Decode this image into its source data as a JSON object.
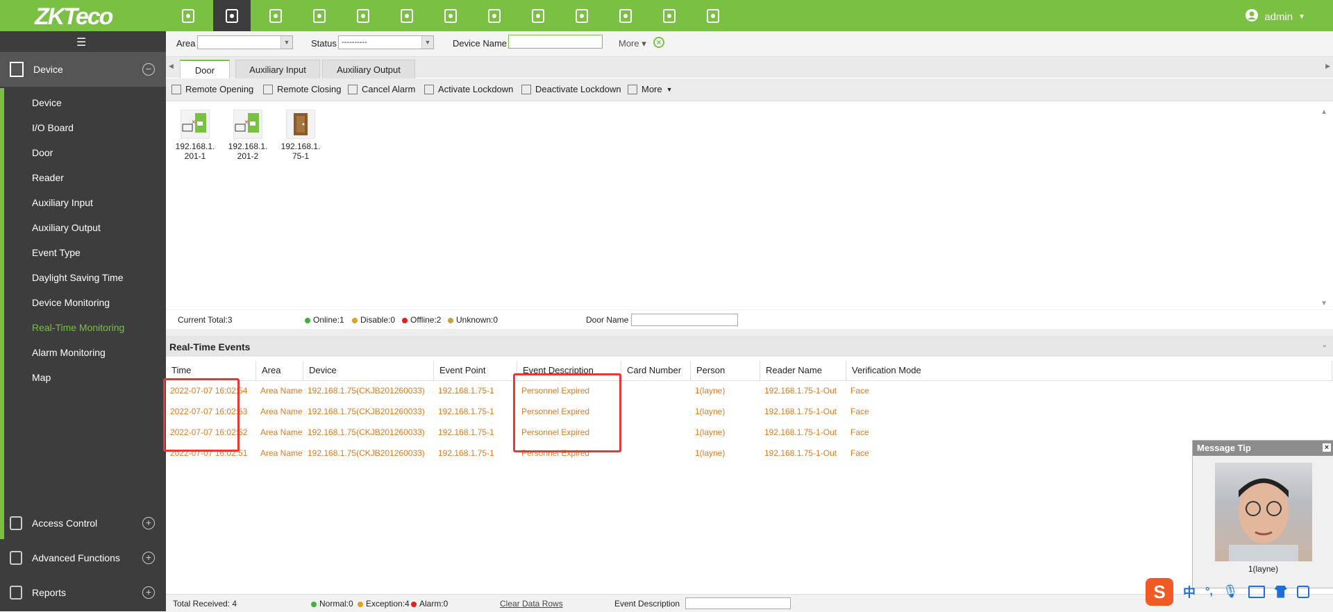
{
  "brand": {
    "logo": "ZKTeco"
  },
  "topnav": {
    "icons": [
      "personnel-icon",
      "access-door-icon",
      "time-attendance-icon",
      "visitor-icon",
      "elevator-icon",
      "consumption-icon",
      "parking-icon",
      "patrol-icon",
      "office-icon",
      "locker-icon",
      "video-icon",
      "security-icon",
      "settings-icon"
    ],
    "user": "admin"
  },
  "sidebar": {
    "section_title": "Device",
    "items": [
      "Device",
      "I/O Board",
      "Door",
      "Reader",
      "Auxiliary Input",
      "Auxiliary Output",
      "Event Type",
      "Daylight Saving Time",
      "Device Monitoring",
      "Real-Time Monitoring",
      "Alarm Monitoring",
      "Map"
    ],
    "active_item": "Real-Time Monitoring",
    "sections": [
      "Access Control",
      "Advanced Functions",
      "Reports"
    ]
  },
  "filter": {
    "area_label": "Area",
    "area_value": "",
    "status_label": "Status",
    "status_value": "----------",
    "device_name_label": "Device Name",
    "device_name_value": "",
    "more_label": "More"
  },
  "tabs": [
    "Door",
    "Auxiliary Input",
    "Auxiliary Output"
  ],
  "toolbar": [
    "Remote Opening",
    "Remote Closing",
    "Cancel Alarm",
    "Activate Lockdown",
    "Deactivate Lockdown",
    "More"
  ],
  "doors": [
    {
      "line1": "192.168.1.",
      "line2": "201-1",
      "state": "offline"
    },
    {
      "line1": "192.168.1.",
      "line2": "201-2",
      "state": "offline"
    },
    {
      "line1": "192.168.1.",
      "line2": "75-1",
      "state": "online"
    }
  ],
  "status": {
    "current_total": "Current Total:3",
    "online": "Online:1",
    "disable": "Disable:0",
    "offline": "Offline:2",
    "unknown": "Unknown:0",
    "door_name_label": "Door Name"
  },
  "events": {
    "title": "Real-Time Events",
    "columns": [
      "Time",
      "Area",
      "Device",
      "Event Point",
      "Event Description",
      "Card Number",
      "Person",
      "Reader Name",
      "Verification Mode"
    ],
    "rows": [
      [
        "2022-07-07 16:02:54",
        "Area Name",
        "192.168.1.75(CKJB201260033)",
        "192.168.1.75-1",
        "Personnel Expired",
        "",
        "1(layne)",
        "192.168.1.75-1-Out",
        "Face"
      ],
      [
        "2022-07-07 16:02:53",
        "Area Name",
        "192.168.1.75(CKJB201260033)",
        "192.168.1.75-1",
        "Personnel Expired",
        "",
        "1(layne)",
        "192.168.1.75-1-Out",
        "Face"
      ],
      [
        "2022-07-07 16:02:52",
        "Area Name",
        "192.168.1.75(CKJB201260033)",
        "192.168.1.75-1",
        "Personnel Expired",
        "",
        "1(layne)",
        "192.168.1.75-1-Out",
        "Face"
      ],
      [
        "2022-07-07 16:02:51",
        "Area Name",
        "192.168.1.75(CKJB201260033)",
        "192.168.1.75-1",
        "Personnel Expired",
        "",
        "1(layne)",
        "192.168.1.75-1-Out",
        "Face"
      ]
    ]
  },
  "message_tip": {
    "title": "Message Tip",
    "person": "1(layne)"
  },
  "bottom": {
    "total_received": "Total Received: 4",
    "normal": "Normal:0",
    "exception": "Exception:4",
    "alarm": "Alarm:0",
    "clear": "Clear Data Rows",
    "event_description_label": "Event Description"
  },
  "ime": {
    "lang": "中",
    "punct": "°,"
  },
  "colors": {
    "brand_green": "#7ac143",
    "sidebar_bg": "#3d3d3d",
    "event_orange": "#e07b1f",
    "highlight_red": "#e53935"
  }
}
